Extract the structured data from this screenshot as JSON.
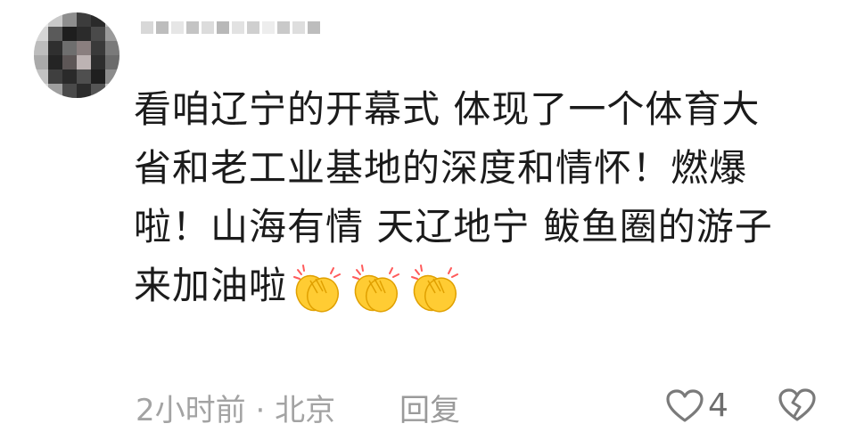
{
  "comment": {
    "user": {
      "avatar_alt": "blurred-user-avatar",
      "username_masked": true
    },
    "text_lines": [
      "看咱辽宁的开幕式 体现了一个体育大",
      "省和老工业基地的深度和情怀！燃爆",
      "啦！山海有情 天辽地宁 鲅鱼圈的游子",
      "来加油啦"
    ],
    "emoji": {
      "icon": "clapping-hands-icon",
      "count": 3
    },
    "meta": {
      "time": "2小时前",
      "separator": "·",
      "location": "北京",
      "reply_label": "回复"
    },
    "actions": {
      "like_icon": "heart-outline-icon",
      "like_count": "4",
      "dislike_icon": "broken-heart-icon"
    }
  },
  "colors": {
    "text": "#1b1b1b",
    "meta": "#a3a3a3",
    "icon": "#7a7a7a",
    "emoji": "#ffcc33"
  }
}
